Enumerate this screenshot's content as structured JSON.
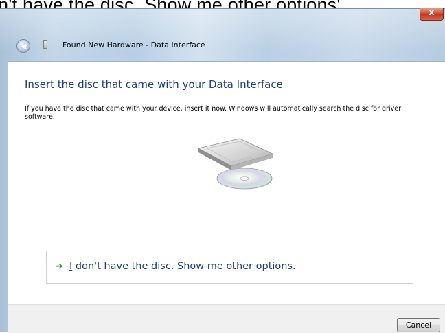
{
  "caption": "n't have the disc. Show me other options'.",
  "window": {
    "title": "Found New Hardware - Data Interface",
    "close_glyph": "x"
  },
  "content": {
    "heading": "Insert the disc that came with your Data Interface",
    "body": "If you have the disc that came with your device, insert it now.  Windows will automatically search the disc for driver software.",
    "option": {
      "accel": "I",
      "rest": " don't have the disc.  Show me other options."
    }
  },
  "footer": {
    "cancel_label": "Cancel"
  },
  "colors": {
    "heading": "#1e3c82",
    "arrow": "#2fa330",
    "close": "#c0341c"
  },
  "icons": [
    "back-arrow-icon",
    "device-icon",
    "disc-drive-illustration",
    "green-arrow-icon",
    "close-icon"
  ]
}
